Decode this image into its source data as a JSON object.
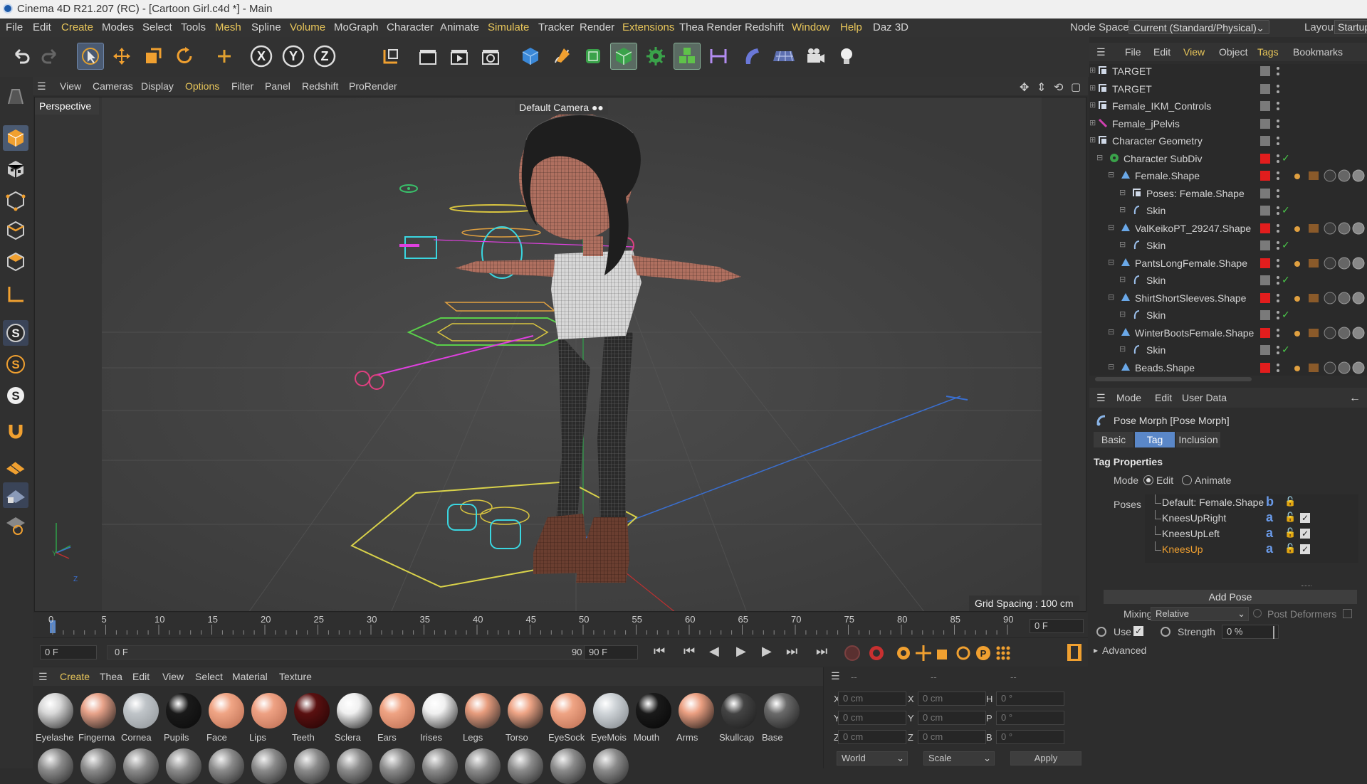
{
  "window": {
    "title": "Cinema 4D R21.207 (RC) - [Cartoon Girl.c4d *] - Main"
  },
  "menubar": {
    "items": [
      "File",
      "Edit",
      "Create",
      "Modes",
      "Select",
      "Tools",
      "Mesh",
      "Spline",
      "Volume",
      "MoGraph",
      "Character",
      "Animate",
      "Simulate",
      "Tracker",
      "Render",
      "Extensions",
      "Thea Render",
      "Redshift",
      "Window",
      "Help",
      "Daz 3D"
    ],
    "node_space_label": "Node Space:",
    "node_space_value": "Current (Standard/Physical)",
    "layout_label": "Layout:",
    "layout_value": "Startup"
  },
  "viewport": {
    "menu": [
      "View",
      "Cameras",
      "Display",
      "Options",
      "Filter",
      "Panel",
      "Redshift",
      "ProRender"
    ],
    "view_name": "Perspective",
    "camera": "Default Camera",
    "grid_spacing": "Grid Spacing : 100 cm"
  },
  "timeline": {
    "ticks": [
      "0",
      "5",
      "10",
      "15",
      "20",
      "25",
      "30",
      "35",
      "40",
      "45",
      "50",
      "55",
      "60",
      "65",
      "70",
      "75",
      "80",
      "85",
      "90"
    ],
    "current_frame": "0 F",
    "start_frame": "0 F",
    "range_start": "0 F",
    "range_end": "90 F",
    "end_frame": "90 F"
  },
  "materials": {
    "menu": [
      "Create",
      "Thea",
      "Edit",
      "View",
      "Select",
      "Material",
      "Texture"
    ],
    "items": [
      {
        "name": "Eyelashe",
        "color": "#d8d8d8",
        "dark": "#222"
      },
      {
        "name": "Fingerna",
        "color": "#e8a38a",
        "dark": "#151515"
      },
      {
        "name": "Cornea",
        "color": "#bfc4c8",
        "dark": "#8d9296"
      },
      {
        "name": "Pupils",
        "color": "#1a1a1a",
        "dark": "#0a0a0a"
      },
      {
        "name": "Face",
        "color": "#f0a585",
        "dark": "#b86a4e"
      },
      {
        "name": "Lips",
        "color": "#eea183",
        "dark": "#b96a4f"
      },
      {
        "name": "Teeth",
        "color": "#5a1010",
        "dark": "#200404"
      },
      {
        "name": "Sclera",
        "color": "#f0f0f0",
        "dark": "#111"
      },
      {
        "name": "Ears",
        "color": "#efa383",
        "dark": "#b86b4f"
      },
      {
        "name": "Irises",
        "color": "#f0f0f0",
        "dark": "#222"
      },
      {
        "name": "Legs",
        "color": "#e79c7d",
        "dark": "#222"
      },
      {
        "name": "Torso",
        "color": "#efa586",
        "dark": "#151515"
      },
      {
        "name": "EyeSock",
        "color": "#efa484",
        "dark": "#b96b4f"
      },
      {
        "name": "EyeMois",
        "color": "#cfd4d8",
        "dark": "#7b8085"
      },
      {
        "name": "Mouth",
        "color": "#1a1a1a",
        "dark": "#050505"
      },
      {
        "name": "Arms",
        "color": "#eca082",
        "dark": "#111"
      },
      {
        "name": "Skullcap",
        "color": "#444",
        "dark": "#1a1a1a"
      },
      {
        "name": "Base",
        "color": "#6a6a6a",
        "dark": "#1a1a1a"
      }
    ]
  },
  "coords": {
    "headers": [
      "--",
      "--",
      "--"
    ],
    "rows": [
      {
        "a": "X",
        "av": "0 cm",
        "b": "X",
        "bv": "0 cm",
        "c": "H",
        "cv": "0 °"
      },
      {
        "a": "Y",
        "av": "0 cm",
        "b": "Y",
        "bv": "0 cm",
        "c": "P",
        "cv": "0 °"
      },
      {
        "a": "Z",
        "av": "0 cm",
        "b": "Z",
        "bv": "0 cm",
        "c": "B",
        "cv": "0 °"
      }
    ],
    "world": "World",
    "scale": "Scale",
    "apply": "Apply"
  },
  "object_manager": {
    "menu": [
      "File",
      "Edit",
      "View",
      "Object",
      "Tags",
      "Bookmarks"
    ],
    "objects": [
      {
        "name": "TARGET",
        "indent": 0,
        "icon": "null",
        "red": false,
        "check": false
      },
      {
        "name": "TARGET",
        "indent": 0,
        "icon": "null",
        "red": false,
        "check": false
      },
      {
        "name": "Female_IKM_Controls",
        "indent": 0,
        "icon": "null",
        "red": false,
        "check": false
      },
      {
        "name": "Female_jPelvis",
        "indent": 0,
        "icon": "joint",
        "red": false,
        "check": false
      },
      {
        "name": "Character Geometry",
        "indent": 0,
        "icon": "null",
        "red": false,
        "check": false
      },
      {
        "name": "Character SubDiv",
        "indent": 1,
        "icon": "subdiv",
        "red": true,
        "check": true
      },
      {
        "name": "Female.Shape",
        "indent": 2,
        "icon": "poly",
        "red": true,
        "check": false
      },
      {
        "name": "Poses: Female.Shape",
        "indent": 3,
        "icon": "null",
        "red": false,
        "check": false
      },
      {
        "name": "Skin",
        "indent": 3,
        "icon": "skin",
        "red": false,
        "check": true
      },
      {
        "name": "ValKeikoPT_29247.Shape",
        "indent": 2,
        "icon": "poly",
        "red": true,
        "check": false
      },
      {
        "name": "Skin",
        "indent": 3,
        "icon": "skin",
        "red": false,
        "check": true
      },
      {
        "name": "PantsLongFemale.Shape",
        "indent": 2,
        "icon": "poly",
        "red": true,
        "check": false
      },
      {
        "name": "Skin",
        "indent": 3,
        "icon": "skin",
        "red": false,
        "check": true
      },
      {
        "name": "ShirtShortSleeves.Shape",
        "indent": 2,
        "icon": "poly",
        "red": true,
        "check": false
      },
      {
        "name": "Skin",
        "indent": 3,
        "icon": "skin",
        "red": false,
        "check": true
      },
      {
        "name": "WinterBootsFemale.Shape",
        "indent": 2,
        "icon": "poly",
        "red": true,
        "check": false
      },
      {
        "name": "Skin",
        "indent": 3,
        "icon": "skin",
        "red": false,
        "check": true
      },
      {
        "name": "Beads.Shape",
        "indent": 2,
        "icon": "poly",
        "red": true,
        "check": false
      }
    ]
  },
  "attributes": {
    "menu": [
      "Mode",
      "Edit",
      "User Data"
    ],
    "title": "Pose Morph [Pose Morph]",
    "tabs": [
      "Basic",
      "Tag",
      "Inclusion"
    ],
    "section": "Tag Properties",
    "mode_label": "Mode",
    "mode_edit": "Edit",
    "mode_animate": "Animate",
    "poses_label": "Poses",
    "poses": [
      {
        "name": "Default: Female.Shape",
        "letter": "b",
        "checked": false,
        "active": false
      },
      {
        "name": "KneesUpRight",
        "letter": "a",
        "checked": true,
        "active": false
      },
      {
        "name": "KneesUpLeft",
        "letter": "a",
        "checked": true,
        "active": false
      },
      {
        "name": "KneesUp",
        "letter": "a",
        "checked": true,
        "active": true
      }
    ],
    "add_pose": "Add Pose",
    "mixing_label": "Mixing",
    "mixing_value": "Relative",
    "post_deformers": "Post Deformers",
    "use_label": "Use",
    "strength_label": "Strength",
    "strength_value": "0 %",
    "advanced": "Advanced"
  }
}
